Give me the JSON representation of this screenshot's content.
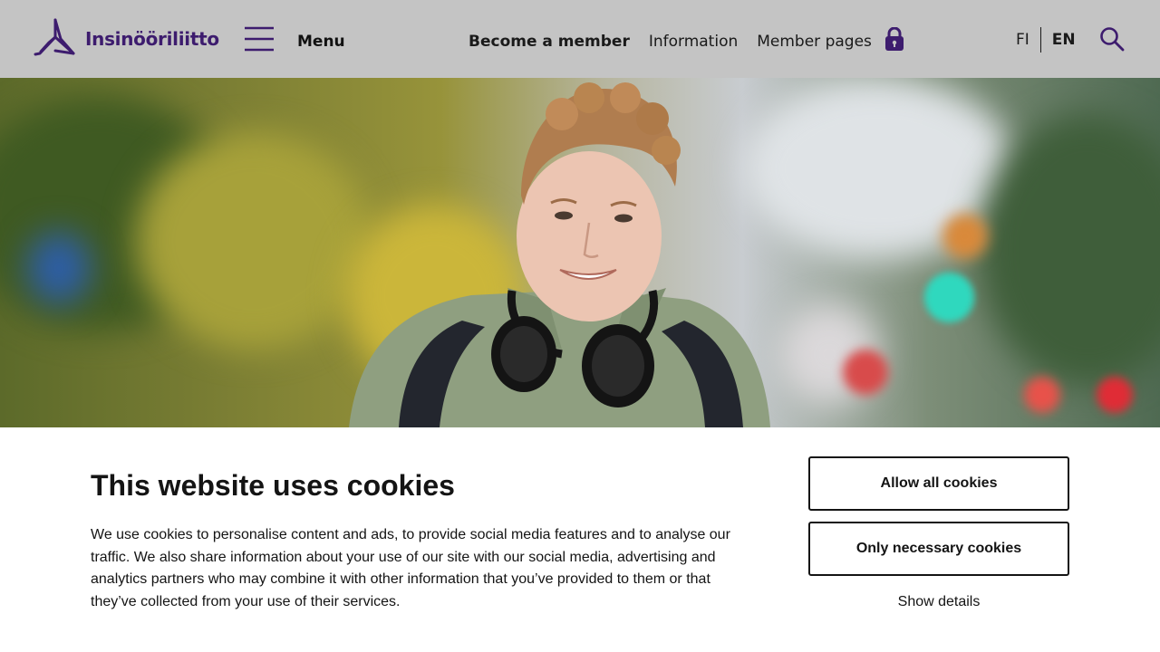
{
  "header": {
    "logo_text": "Insinööriliitto",
    "menu_label": "Menu",
    "nav": {
      "become_member": "Become a member",
      "information": "Information",
      "member_pages": "Member pages"
    },
    "languages": {
      "fi": "FI",
      "en": "EN",
      "active": "EN"
    },
    "icons": {
      "logo": "insinooriliitto-logo-icon",
      "menu": "hamburger-icon",
      "lock": "lock-icon",
      "search": "search-icon"
    }
  },
  "hero": {
    "image": "smiling-person-with-headphones-photo"
  },
  "cookie_banner": {
    "title": "This website uses cookies",
    "text": "We use cookies to personalise content and ads, to provide social media features and to analyse our traffic. We also share information about your use of our site with our social media, advertising and analytics partners who may combine it with other information that you’ve provided to them or that they’ve collected from your use of their services.",
    "allow_all": "Allow all cookies",
    "only_necessary": "Only necessary cookies",
    "show_details": "Show details"
  },
  "colors": {
    "brand_purple": "#3d1c6e",
    "header_bg": "#c4c4c4",
    "text": "#141414"
  }
}
